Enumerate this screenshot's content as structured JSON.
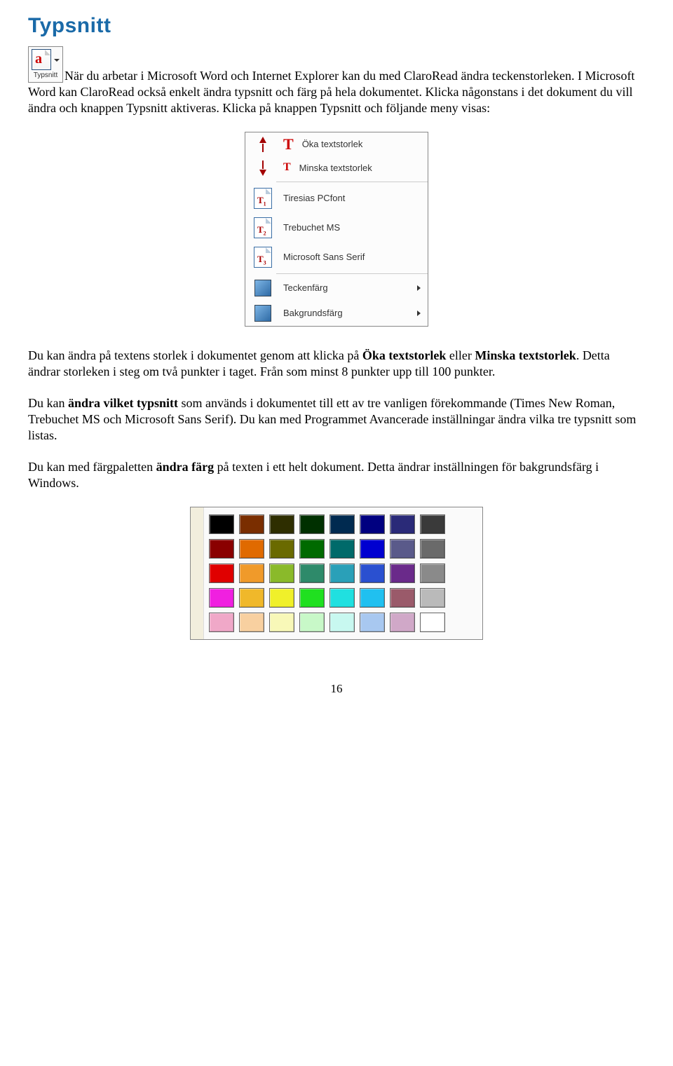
{
  "heading": "Typsnitt",
  "button_label": "Typsnitt",
  "para1_a": "När du arbetar i Microsoft Word och Internet Explorer kan du med ClaroRead ändra teckenstorleken. I Microsoft Word kan ClaroRead också enkelt ändra typsnitt och färg på hela dokumentet. Klicka någonstans i det dokument du vill ändra och knappen Typsnitt aktiveras. Klicka på knappen Typsnitt och följande meny visas:",
  "menu": {
    "increase": "Öka textstorlek",
    "decrease": "Minska textstorlek",
    "font1": "Tiresias PCfont",
    "font2": "Trebuchet MS",
    "font3": "Microsoft Sans Serif",
    "textcolor": "Teckenfärg",
    "bgcolor": "Bakgrundsfärg"
  },
  "para2_a": "Du kan ändra på textens storlek i dokumentet genom att klicka på ",
  "para2_b": "Öka textstorlek",
  "para2_c": " eller ",
  "para2_d": "Minska textstorlek",
  "para2_e": ". Detta ändrar storleken i steg om två punkter i taget. Från som minst 8 punkter upp till 100 punkter.",
  "para3_a": "Du kan ",
  "para3_b": "ändra vilket typsnitt",
  "para3_c": " som används i dokumentet till ett av tre vanligen förekommande (Times New Roman, Trebuchet MS och Microsoft Sans Serif). Du kan med Programmet Avancerade inställningar ändra vilka tre typsnitt som listas.",
  "para4_a": "Du kan med färgpaletten ",
  "para4_b": "ändra färg",
  "para4_c": " på texten i ett helt dokument. Detta ändrar inställningen för bakgrundsfärg i Windows.",
  "palette_colors": [
    "#000000",
    "#7a2e00",
    "#2e2e00",
    "#003000",
    "#002a50",
    "#000080",
    "#2a2a78",
    "#3a3a3a",
    "#8a0000",
    "#e06a00",
    "#6a6a00",
    "#006a00",
    "#006a6a",
    "#0000d0",
    "#5a5a8a",
    "#6a6a6a",
    "#e00000",
    "#f09a2a",
    "#8aba2a",
    "#2e8a6a",
    "#2aa0b8",
    "#2a50d0",
    "#6a2a8a",
    "#8a8a8a",
    "#f020e0",
    "#f0b82a",
    "#f0f02a",
    "#20e020",
    "#20e0e0",
    "#20c0f0",
    "#9a5a6a",
    "#bababa",
    "#f0a8c8",
    "#f8d0a0",
    "#f8f8b8",
    "#c8f8c8",
    "#c8f8f0",
    "#a8c8f0",
    "#d0a8c8",
    "#ffffff"
  ],
  "page_number": "16"
}
